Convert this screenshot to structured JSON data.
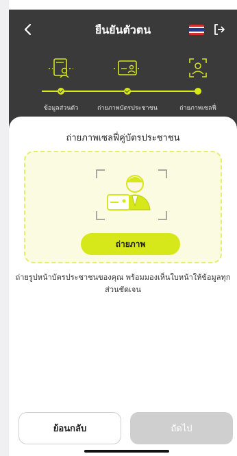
{
  "header": {
    "title": "ยืนยันตัวตน",
    "back_icon": "chevron-left-icon",
    "flag_icon": "thai-flag-icon",
    "logout_icon": "logout-icon",
    "bg_color": "#3a3a3a",
    "accent_color": "#d6e71a"
  },
  "steps": [
    {
      "label": "ข้อมูลส่วนตัว",
      "icon": "user-document-icon",
      "status": "done"
    },
    {
      "label": "ถ่ายภาพบัตรประชาชน",
      "icon": "id-card-icon",
      "status": "done"
    },
    {
      "label": "ถ่ายภาพเซลฟี่",
      "icon": "face-scan-icon",
      "status": "current"
    }
  ],
  "main": {
    "title": "ถ่ายภาพเซลฟี่คู่บัตรประชาชน",
    "illustration_icon": "selfie-with-id-icon",
    "capture_label": "ถ่ายภาพ",
    "description": "ถ่ายรูปหน้าบัตรประชาชนของคุณ พร้อมมองเห็นใบหน้าให้ข้อมูลทุกส่วนชัดเจน"
  },
  "footer": {
    "back_label": "ย้อนกลับ",
    "next_label": "ถัดไป",
    "next_enabled": false
  }
}
